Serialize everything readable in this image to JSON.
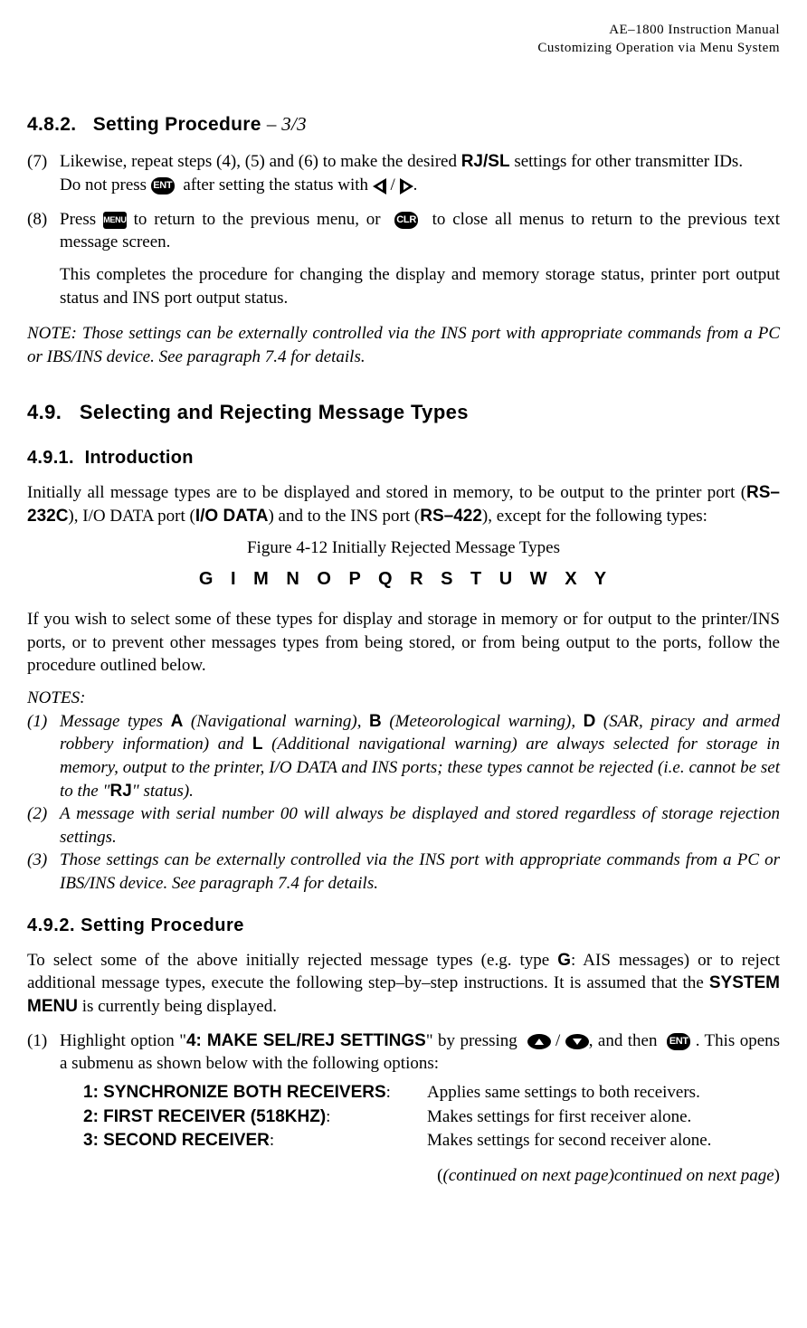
{
  "header": {
    "line1": "AE–1800 Instruction Manual",
    "line2": "Customizing Operation via Menu System"
  },
  "s482": {
    "heading_number": "4.8.2.",
    "heading_text": "Setting Procedure",
    "dash": "–",
    "page_frac": "3/3"
  },
  "step7": {
    "num": "(7)",
    "text1a": "Likewise, repeat steps (4), (5) and (6) to make the desired ",
    "rjsl": "RJ/SL",
    "text1b": " settings for other transmitter IDs.",
    "text2a": "Do not press ",
    "ent": "ENT",
    "text2b": " after setting the status with ",
    "slash": " / ",
    "text2c": "."
  },
  "step8": {
    "num": "(8)",
    "text1a": "Press ",
    "menu": "MENU",
    "text1b": " to return to the previous menu, or ",
    "clr": "CLR",
    "text1c": " to close all menus to return to the previous text message screen.",
    "text2": "This completes the procedure for changing the display and memory storage status, printer port output status and INS port output status."
  },
  "note1": "NOTE: Those settings can be externally controlled via the INS port with appropriate commands from a PC or IBS/INS device. See paragraph 7.4 for details.",
  "s49": {
    "num": "4.9.",
    "title": "Selecting and Rejecting Message Types"
  },
  "s491": {
    "num": "4.9.1.",
    "title": "Introduction"
  },
  "intro_para": {
    "a": "Initially all message types are to be displayed and stored in memory, to be output to the printer port (",
    "rs232c": "RS–232C",
    "b": "), I/O DATA port (",
    "iodata": "I/O DATA",
    "c": ") and to the INS port (",
    "rs422": "RS–422",
    "d": "), except for the following types:"
  },
  "figure_caption": "Figure 4-12    Initially Rejected Message Types",
  "letters": "G  I  M  N  O  P  Q  R  S  T  U  W  X  Y",
  "para_select": "If you wish to select some of these types for display and storage in memory or for output to the printer/INS ports, or to prevent other messages types from being stored, or from being output to the ports, follow the procedure outlined below.",
  "notes_label": "NOTES:",
  "noteA": {
    "num": "(1)",
    "a": "Message types ",
    "A": "A",
    "b": " (Navigational warning), ",
    "B": "B",
    "c": " (Meteorological warning), ",
    "D": "D",
    "d": " (SAR, piracy and armed robbery information) and ",
    "L": "L",
    "e": " (Additional navigational warning) are always selected for storage in memory, output to the printer, I/O DATA and INS ports; these types cannot be rejected (i.e. cannot be set to the \"",
    "RJ": "RJ",
    "f": "\" status)."
  },
  "noteB": {
    "num": "(2)",
    "text": "A message with serial number 00 will always be displayed and stored regardless of storage rejection settings."
  },
  "noteC": {
    "num": "(3)",
    "text": "Those settings can be externally controlled via the INS port with appropriate commands from a PC or IBS/INS device. See paragraph 7.4 for details."
  },
  "s492": {
    "num": "4.9.2.",
    "title": "Setting Procedure"
  },
  "proc_intro": {
    "a": "To select some of the above initially rejected message types (e.g. type ",
    "G": "G",
    "b": ": AIS messages) or to reject additional message types, execute the following step–by–step instructions. It is assumed that the ",
    "sysmenu": "SYSTEM MENU",
    "c": " is currently being displayed."
  },
  "proc_step1": {
    "num": "(1)",
    "a": "Highlight option \"",
    "opt": "4: MAKE SEL/REJ SETTINGS",
    "b": "\" by pressing ",
    "slash": " / ",
    "c": ", and then ",
    "ent": "ENT",
    "d": ". This opens a submenu as shown below with the following options:"
  },
  "options": {
    "r1": {
      "label_bold": "1: SYNCHRONIZE BOTH RECEIVERS",
      "colon": ":",
      "desc": "Applies same settings to both receivers."
    },
    "r2": {
      "label_bold": "2: FIRST RECEIVER (518KHZ)",
      "colon": ":",
      "desc": "Makes settings for first receiver alone."
    },
    "r3": {
      "label_bold": "3: SECOND RECEIVER",
      "colon": ":",
      "desc": "Makes settings for second receiver alone."
    }
  },
  "continued": "(continued on next page)"
}
